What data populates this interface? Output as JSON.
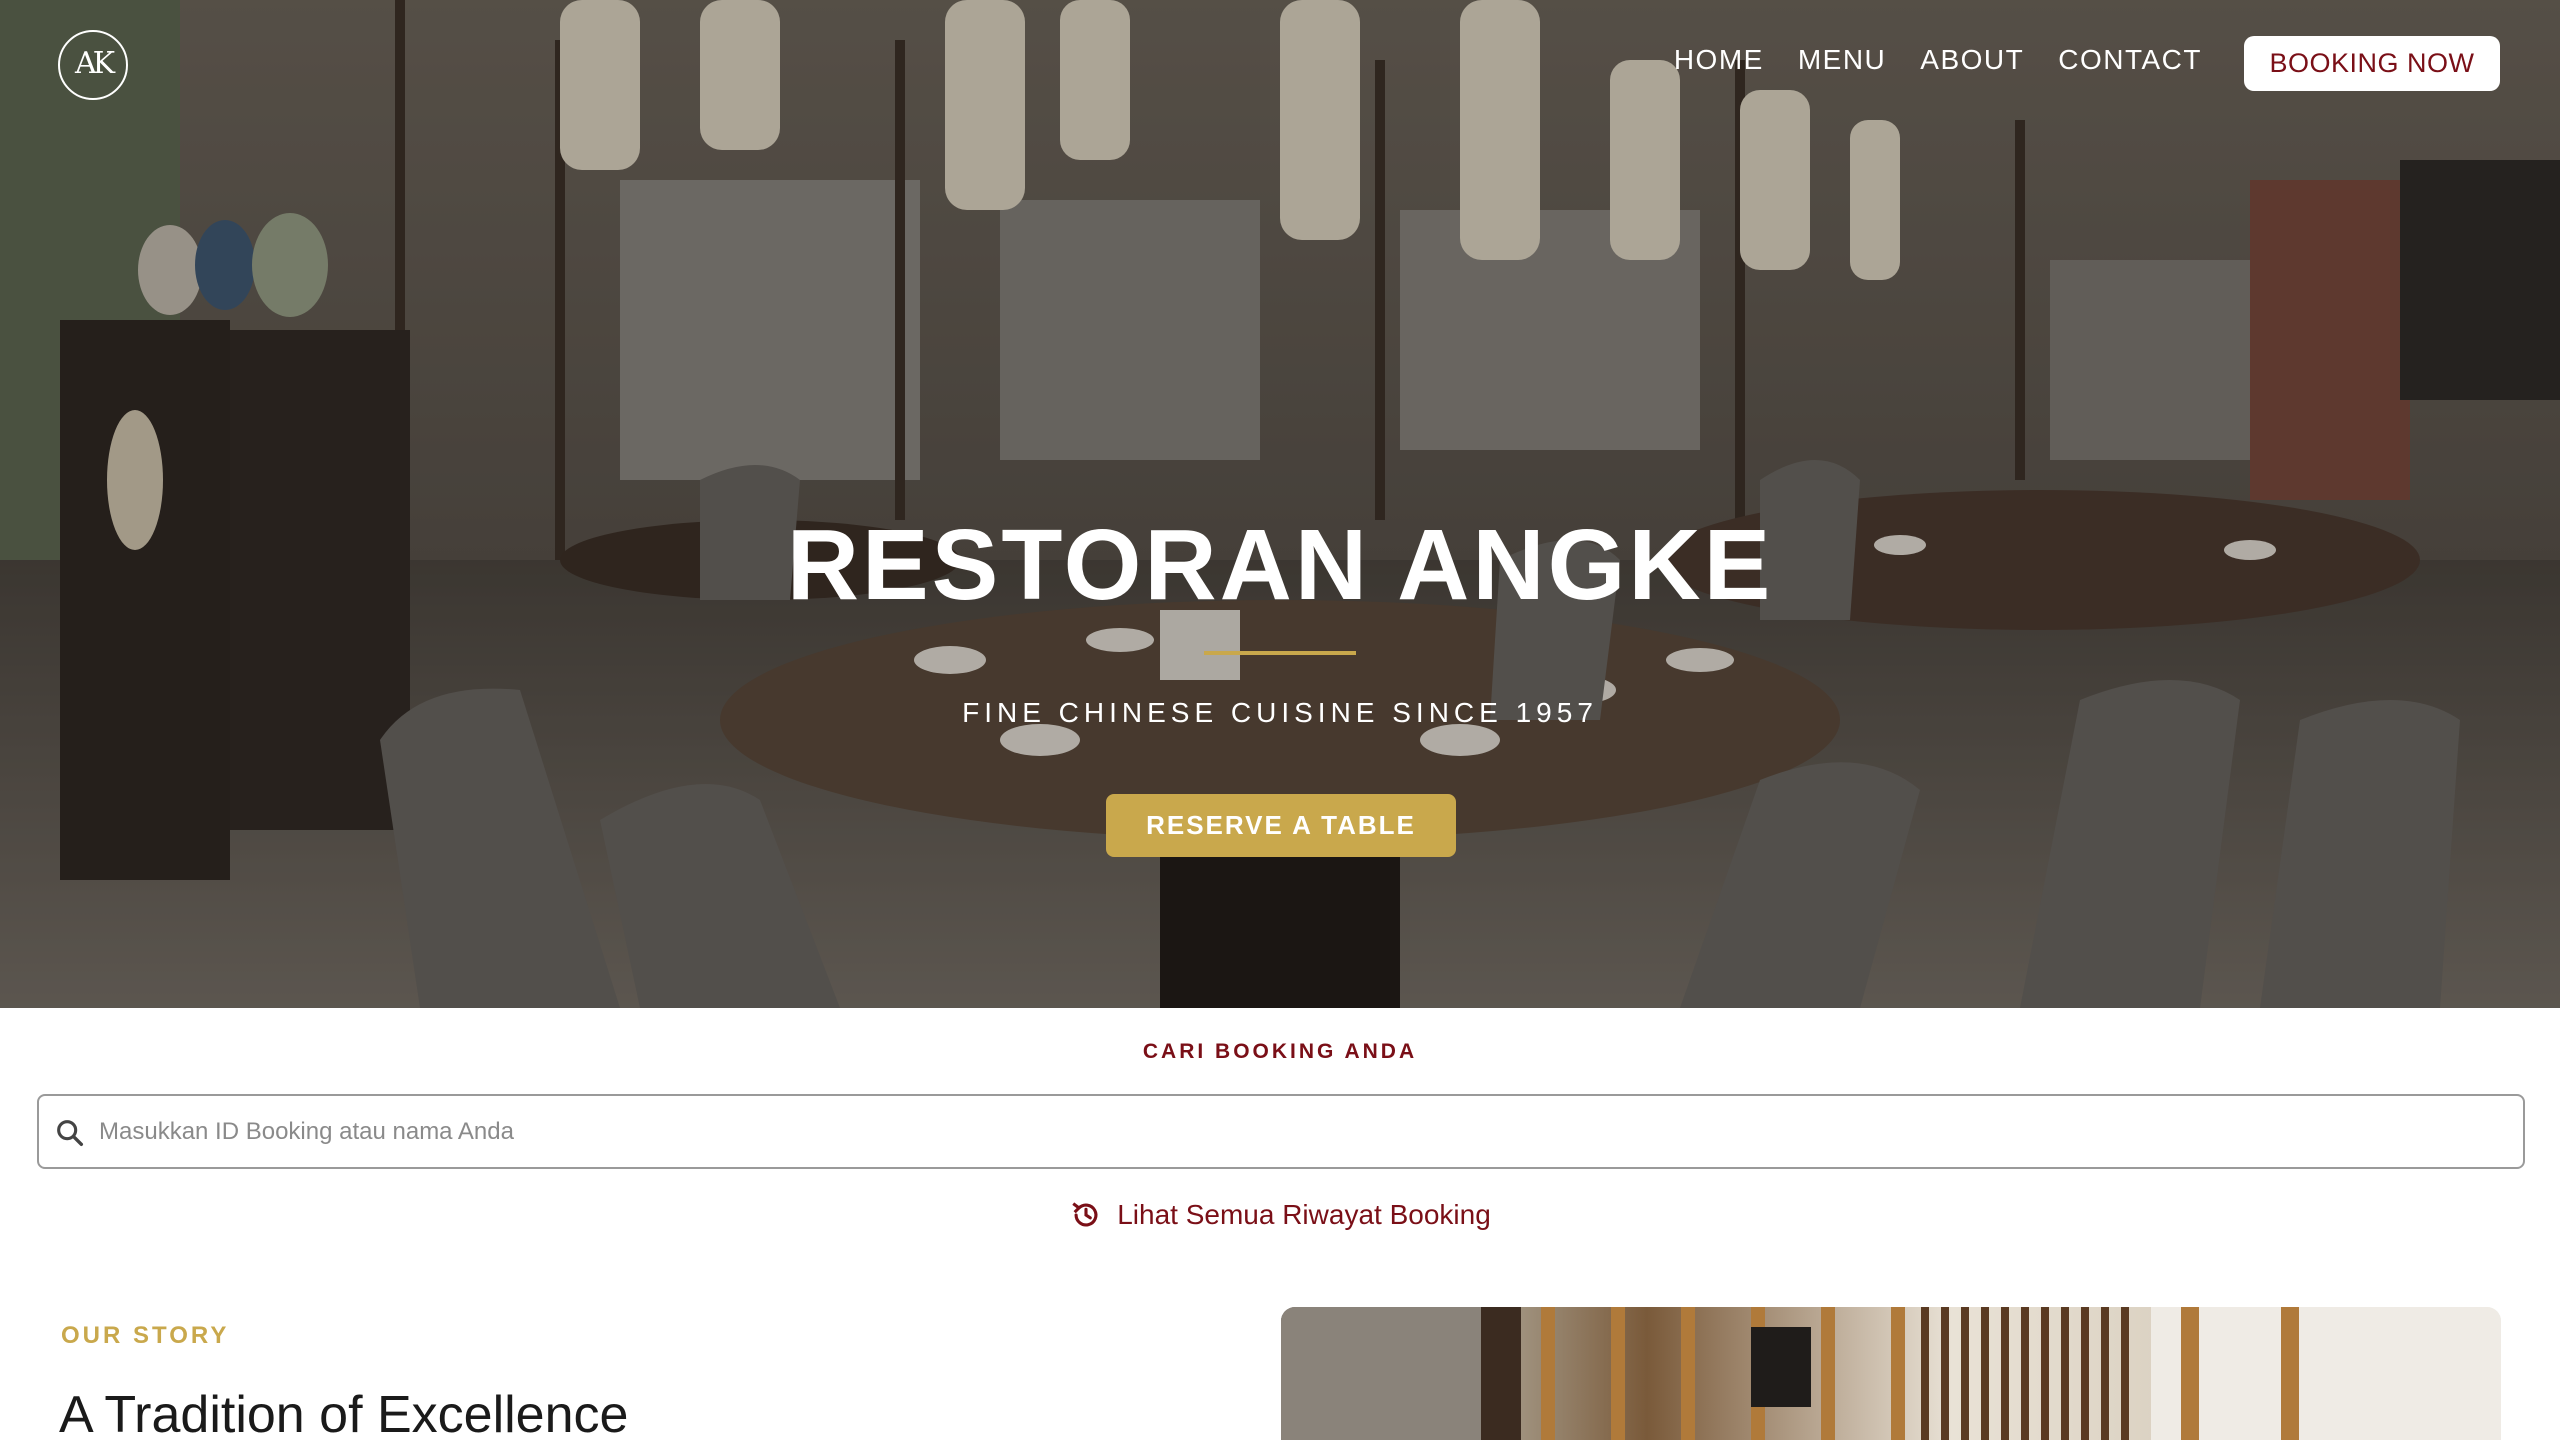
{
  "brand": {
    "logo_text": "AK"
  },
  "nav": {
    "items": [
      {
        "label": "HOME"
      },
      {
        "label": "MENU"
      },
      {
        "label": "ABOUT"
      },
      {
        "label": "CONTACT"
      }
    ],
    "cta_label": "BOOKING NOW"
  },
  "hero": {
    "title": "RESTORAN ANGKE",
    "tagline": "FINE CHINESE CUISINE SINCE 1957",
    "button_label": "RESERVE A TABLE"
  },
  "search": {
    "heading": "CARI BOOKING ANDA",
    "placeholder": "Masukkan ID Booking atau nama Anda",
    "value": "",
    "icon": "search-icon",
    "history_label": "Lihat Semua Riwayat Booking",
    "history_icon": "history-icon"
  },
  "story": {
    "eyebrow": "OUR STORY",
    "title": "A Tradition of Excellence"
  },
  "colors": {
    "brand_red": "#7a0f17",
    "gold": "#c9a84c",
    "white": "#ffffff"
  }
}
